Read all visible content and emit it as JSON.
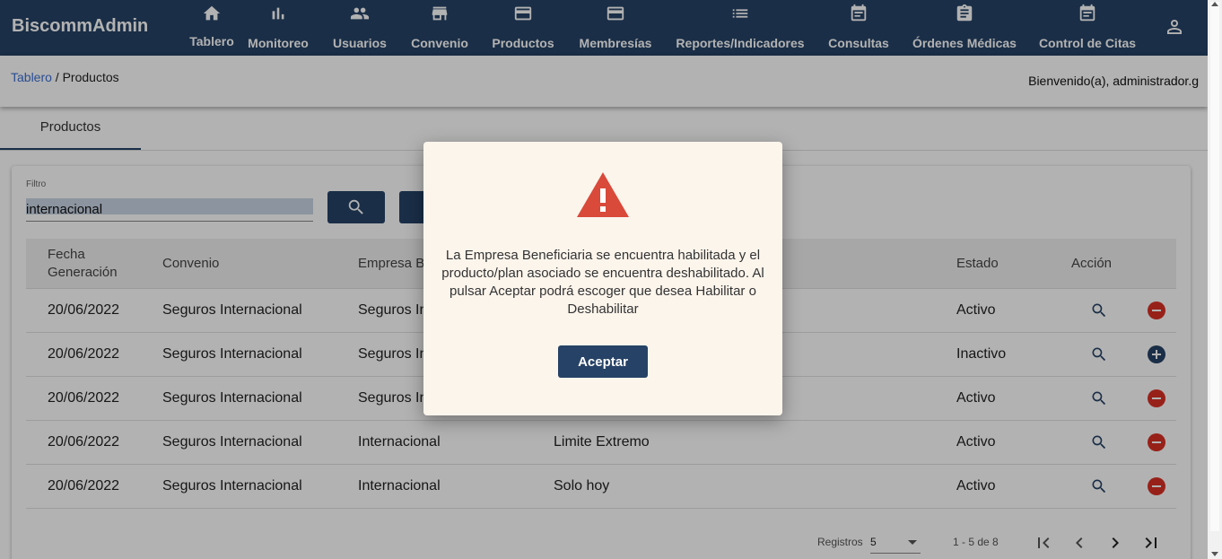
{
  "app": {
    "brand": "BiscommAdmin"
  },
  "nav": [
    {
      "id": "tablero",
      "label": "Tablero",
      "icon": "home-icon"
    },
    {
      "id": "monitoreo",
      "label": "Monitoreo",
      "icon": "bar-chart-icon"
    },
    {
      "id": "usuarios",
      "label": "Usuarios",
      "icon": "group-icon"
    },
    {
      "id": "convenio",
      "label": "Convenio",
      "icon": "store-icon"
    },
    {
      "id": "productos",
      "label": "Productos",
      "icon": "card-icon"
    },
    {
      "id": "membresias",
      "label": "Membresías",
      "icon": "card-icon"
    },
    {
      "id": "reportes",
      "label": "Reportes/Indicadores",
      "icon": "list-icon"
    },
    {
      "id": "consultas",
      "label": "Consultas",
      "icon": "calendar-icon"
    },
    {
      "id": "ordenes",
      "label": "Órdenes Médicas",
      "icon": "clipboard-icon"
    },
    {
      "id": "citas",
      "label": "Control de Citas",
      "icon": "calendar-icon"
    }
  ],
  "breadcrumb": {
    "root": "Tablero",
    "separator": " / ",
    "current": "Productos"
  },
  "welcome": "Bienvenido(a), administrador.g",
  "tabs": [
    {
      "label": "Productos"
    }
  ],
  "filter": {
    "label": "Filtro",
    "value": "internacional"
  },
  "table": {
    "headers": {
      "fecha_line1": "Fecha",
      "fecha_line2": "Generación",
      "convenio": "Convenio",
      "empresa": "Empresa B",
      "estado": "Estado",
      "accion": "Acción"
    },
    "rows": [
      {
        "fecha": "20/06/2022",
        "convenio": "Seguros Internacional",
        "empresa": "Seguros In",
        "producto": "",
        "estado": "Activo",
        "toggle": "minus"
      },
      {
        "fecha": "20/06/2022",
        "convenio": "Seguros Internacional",
        "empresa": "Seguros In",
        "producto": "",
        "estado": "Inactivo",
        "toggle": "plus"
      },
      {
        "fecha": "20/06/2022",
        "convenio": "Seguros Internacional",
        "empresa": "Seguros In",
        "producto": "",
        "estado": "Activo",
        "toggle": "minus"
      },
      {
        "fecha": "20/06/2022",
        "convenio": "Seguros Internacional",
        "empresa": "Internacional",
        "producto": "Limite Extremo",
        "estado": "Activo",
        "toggle": "minus"
      },
      {
        "fecha": "20/06/2022",
        "convenio": "Seguros Internacional",
        "empresa": "Internacional",
        "producto": "Solo hoy",
        "estado": "Activo",
        "toggle": "minus"
      }
    ]
  },
  "paginator": {
    "label": "Registros",
    "page_size": "5",
    "range": "1 - 5 de 8"
  },
  "dialog": {
    "message": "La Empresa Beneficiaria se encuentra habilitada y el producto/plan asociado se encuentra deshabilitado. Al pulsar Aceptar podrá escoger que desea Habilitar o Deshabilitar",
    "accept_label": "Aceptar",
    "icon": "warning-icon"
  },
  "colors": {
    "primary": "#264266",
    "danger": "#d93025",
    "dialog_bg": "#fcf5ec",
    "link": "#3b6fd4"
  }
}
